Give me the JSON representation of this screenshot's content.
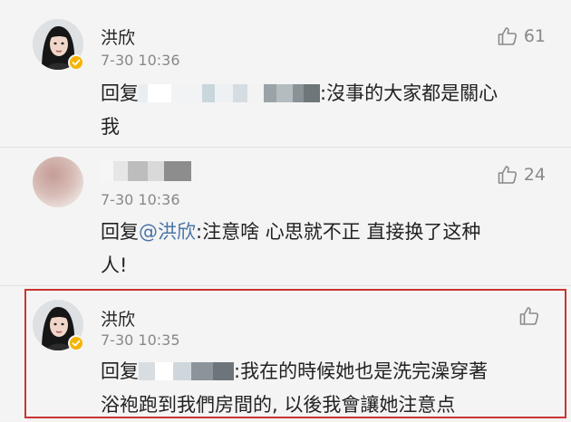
{
  "comments": [
    {
      "username": "洪欣",
      "timestamp": "7-30 10:36",
      "likes": "61",
      "reply_prefix": "回复",
      "text_line1": ":沒事的大家都是關心",
      "text_line2": "我",
      "verified": true,
      "highlighted": false
    },
    {
      "username": "",
      "timestamp": "7-30 10:36",
      "likes": "24",
      "reply_prefix": "回复",
      "mention": "@洪欣",
      "text_line1": ":注意啥 心思就不正 直接换了这种",
      "text_line2": "人!",
      "verified": false,
      "highlighted": false
    },
    {
      "username": "洪欣",
      "timestamp": "7-30 10:35",
      "likes": "",
      "reply_prefix": "回复",
      "text_line1": ":我在的時候她也是洗完澡穿著",
      "text_line2": "浴袍跑到我們房間的, 以後我會讓她注意点",
      "verified": true,
      "highlighted": true
    }
  ],
  "colors": {
    "background": "#f4f4f4",
    "text": "#222222",
    "secondary_text": "#888888",
    "mention": "#4a74a8",
    "highlight_border": "#c83434",
    "verified_badge": "#f4b400"
  },
  "icons": {
    "like": "thumbs-up-icon",
    "verified": "verified-badge-icon"
  }
}
